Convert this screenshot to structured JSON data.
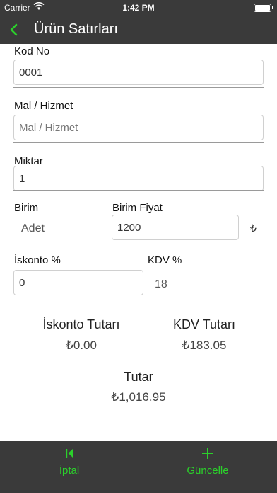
{
  "status": {
    "carrier": "Carrier",
    "time": "1:42 PM"
  },
  "nav": {
    "title": "Ürün Satırları",
    "back_icon": "chevron-left-icon"
  },
  "form": {
    "kod_no": {
      "label": "Kod No",
      "value": "0001"
    },
    "mal_hizmet": {
      "label": "Mal / Hizmet",
      "placeholder": "Mal / Hizmet"
    },
    "miktar": {
      "label": "Miktar",
      "value": "1"
    },
    "birim": {
      "label": "Birim",
      "value": "Adet"
    },
    "birim_fiyat": {
      "label": "Birim Fiyat",
      "value": "1200",
      "currency": "₺"
    },
    "iskonto": {
      "label": "İskonto %",
      "value": "0"
    },
    "kdv": {
      "label": "KDV %",
      "value": "18"
    }
  },
  "summary": {
    "iskonto_tutari": {
      "label": "İskonto Tutarı",
      "value": "₺0.00"
    },
    "kdv_tutari": {
      "label": "KDV Tutarı",
      "value": "₺183.05"
    },
    "tutar": {
      "label": "Tutar",
      "value": "₺1,016.95"
    }
  },
  "toolbar": {
    "cancel": {
      "label": "İptal",
      "icon": "skip-back-icon"
    },
    "update": {
      "label": "Güncelle",
      "icon": "plus-icon"
    }
  },
  "colors": {
    "bar": "#3a3a3a",
    "accent": "#2bd02b"
  }
}
